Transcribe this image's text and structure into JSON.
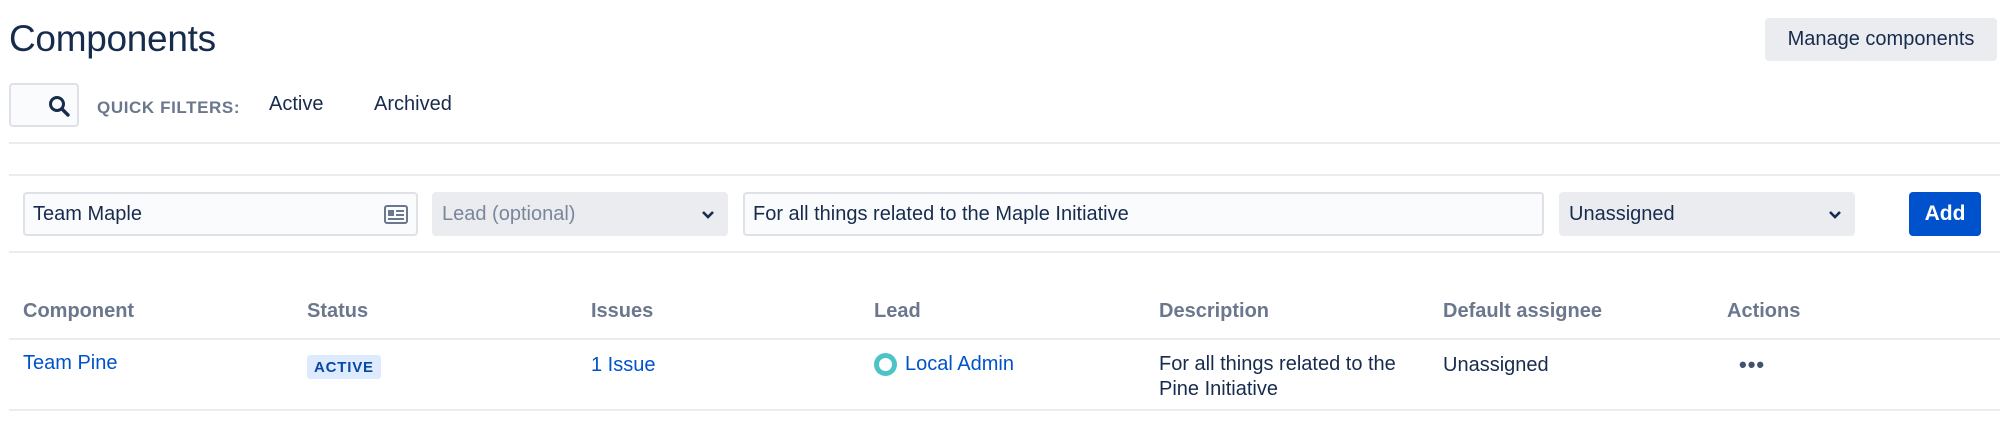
{
  "header": {
    "title": "Components",
    "manage_label": "Manage components"
  },
  "filters": {
    "search_icon": "search-icon",
    "quick_filters_label": "QUICK FILTERS:",
    "items": [
      "Active",
      "Archived"
    ]
  },
  "add_form": {
    "name_value": "Team Maple",
    "name_icon": "id-card-icon",
    "lead_placeholder": "Lead (optional)",
    "description_value": "For all things related to the Maple Initiative",
    "assignee_value": "Unassigned",
    "add_label": "Add"
  },
  "table": {
    "headers": [
      "Component",
      "Status",
      "Issues",
      "Lead",
      "Description",
      "Default assignee",
      "Actions"
    ],
    "rows": [
      {
        "component": "Team Pine",
        "status": "ACTIVE",
        "issues": "1 Issue",
        "lead": "Local Admin",
        "description": "For all things related to the Pine Initiative",
        "default_assignee": "Unassigned",
        "actions": "•••"
      }
    ]
  },
  "colors": {
    "accent": "#0052cc",
    "text": "#172b4d",
    "muted": "#6b778c",
    "status_bg": "#deebff",
    "avatar": "#4bc3c7"
  }
}
